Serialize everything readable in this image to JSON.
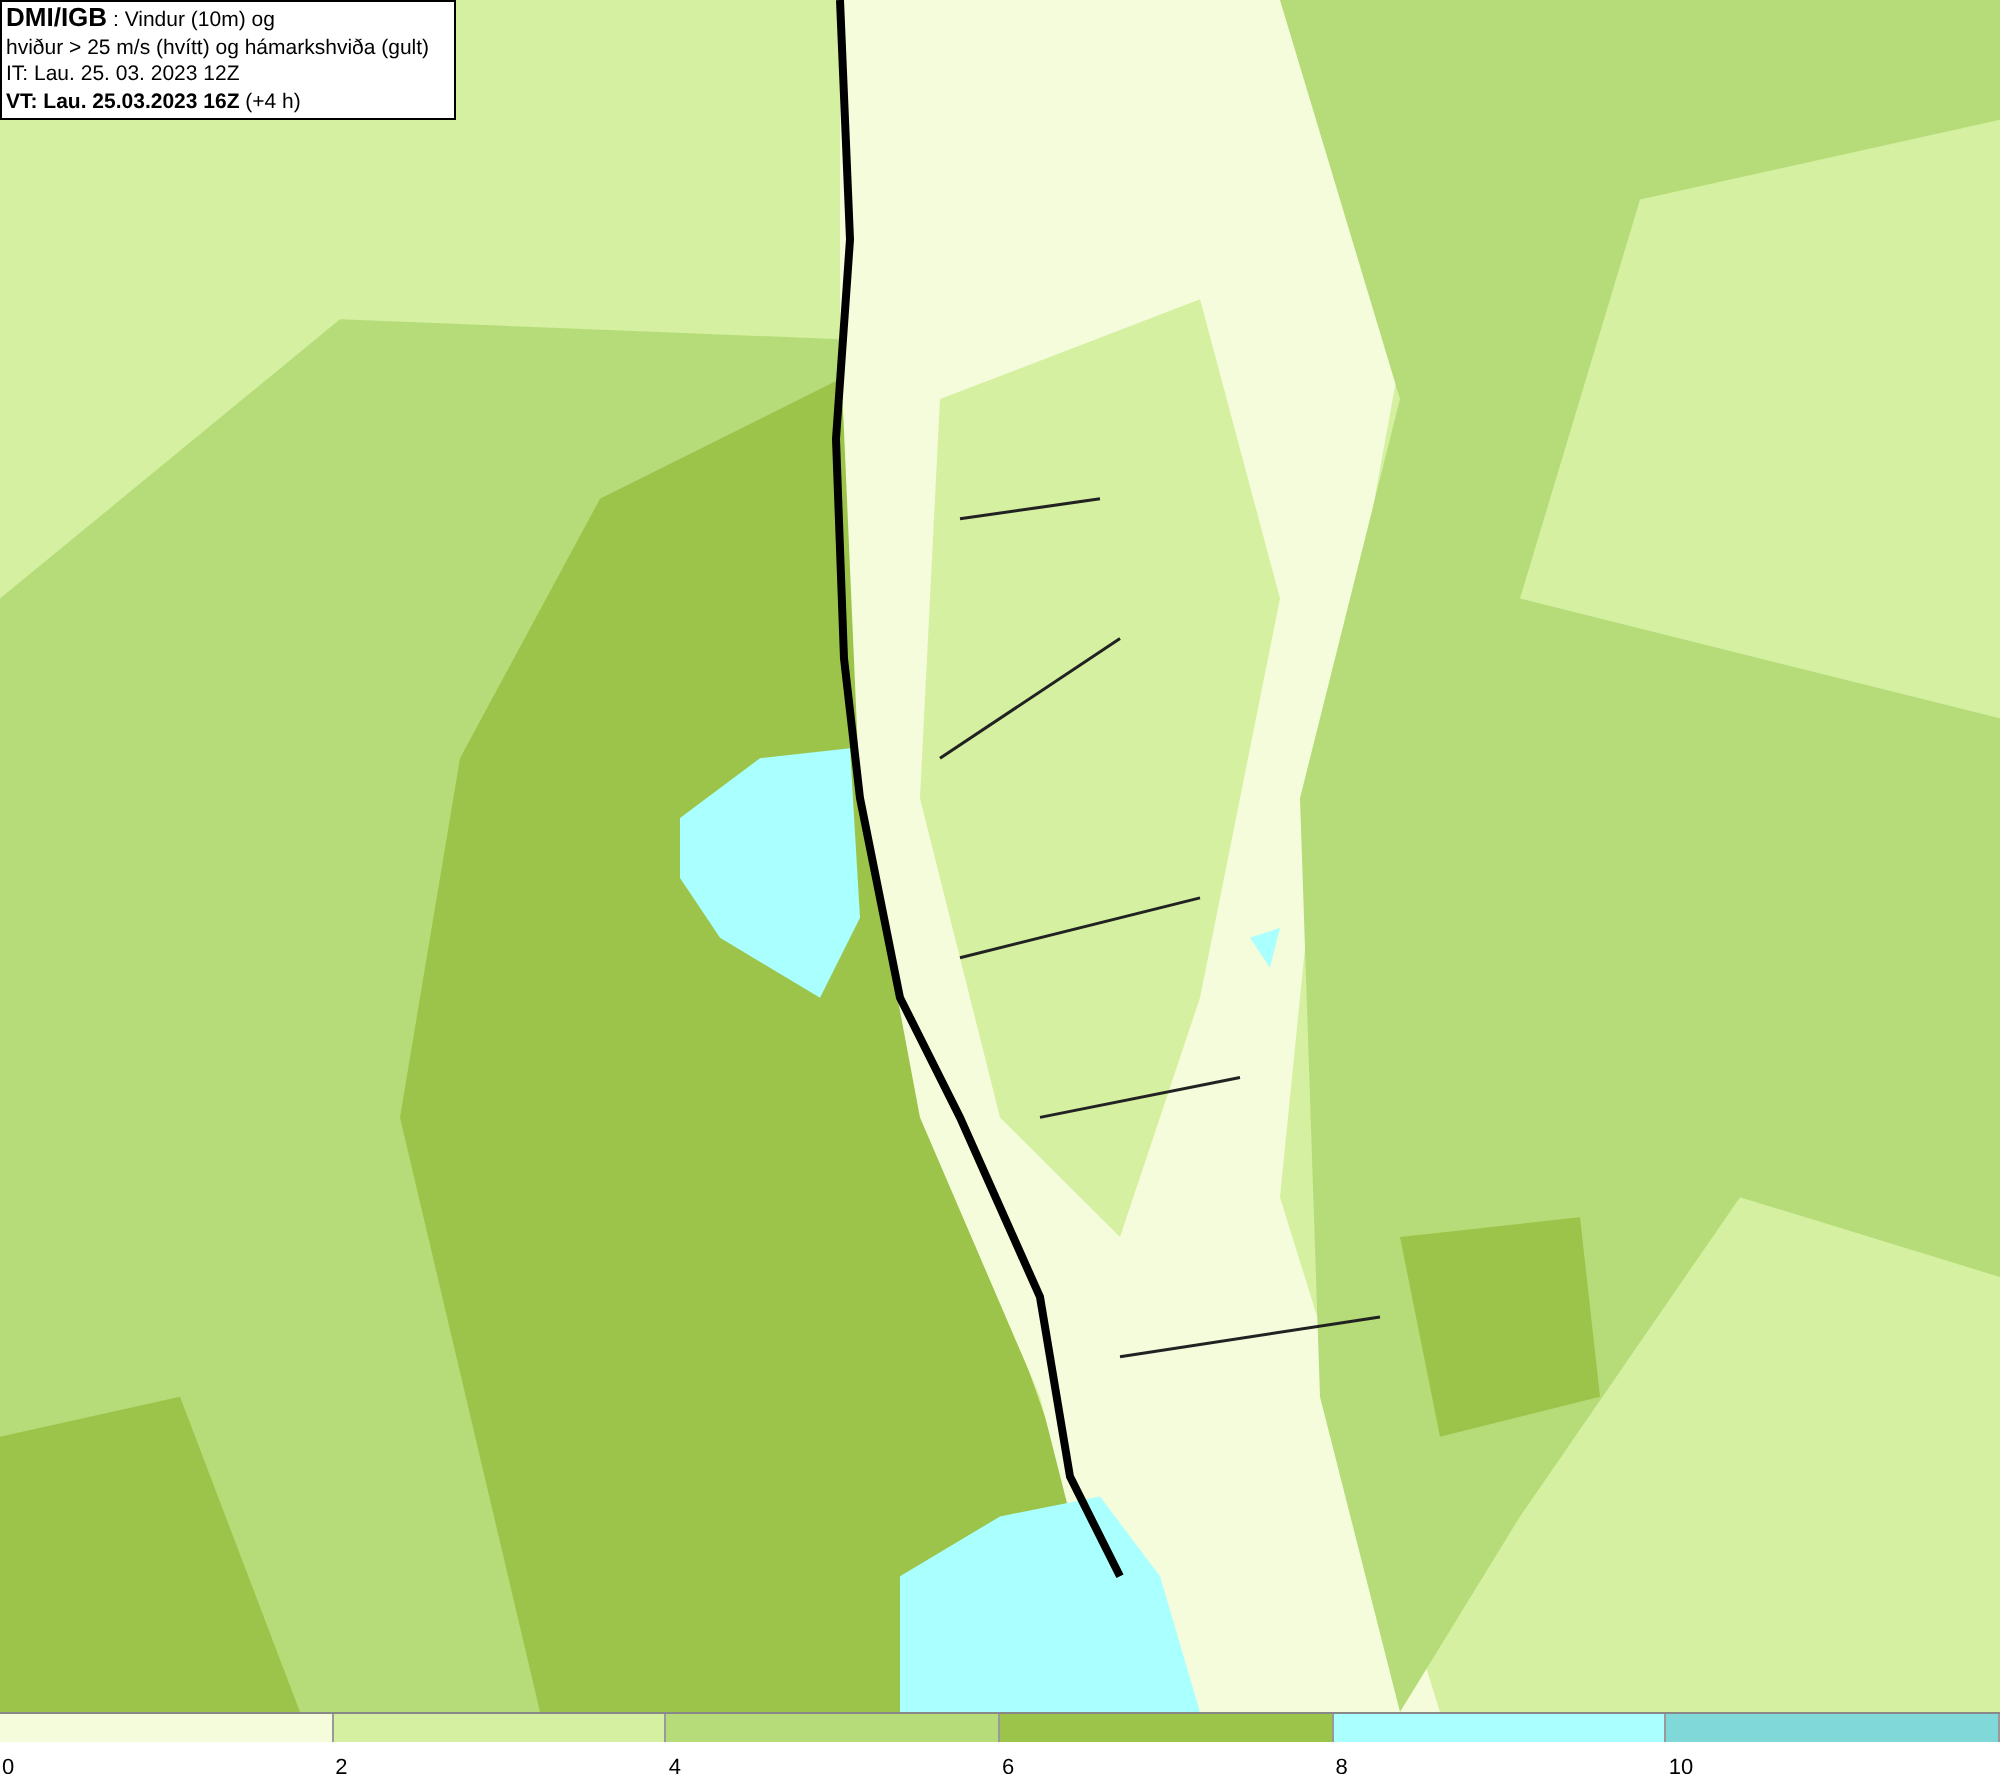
{
  "title_box": {
    "lines": [
      "**DMI/IGB** : Vindur (10m) og",
      "hviður > 25 m/s (hvítt) og hámarkshviða (gult)",
      "IT: Lau. 25. 03. 2023 12Z",
      "**VT: Lau. 25.03.2023 16Z** (+4 h)"
    ]
  },
  "legend": {
    "bins": [
      {
        "color": "#f5fcdc",
        "label": "0"
      },
      {
        "color": "#d4f0a0",
        "label": "2"
      },
      {
        "color": "#b5dc78",
        "label": "4"
      },
      {
        "color": "#9cc44a",
        "label": "6"
      },
      {
        "color": "#aaffff",
        "label": "8"
      },
      {
        "color": "#80d8d8",
        "label": "10"
      }
    ]
  }
}
